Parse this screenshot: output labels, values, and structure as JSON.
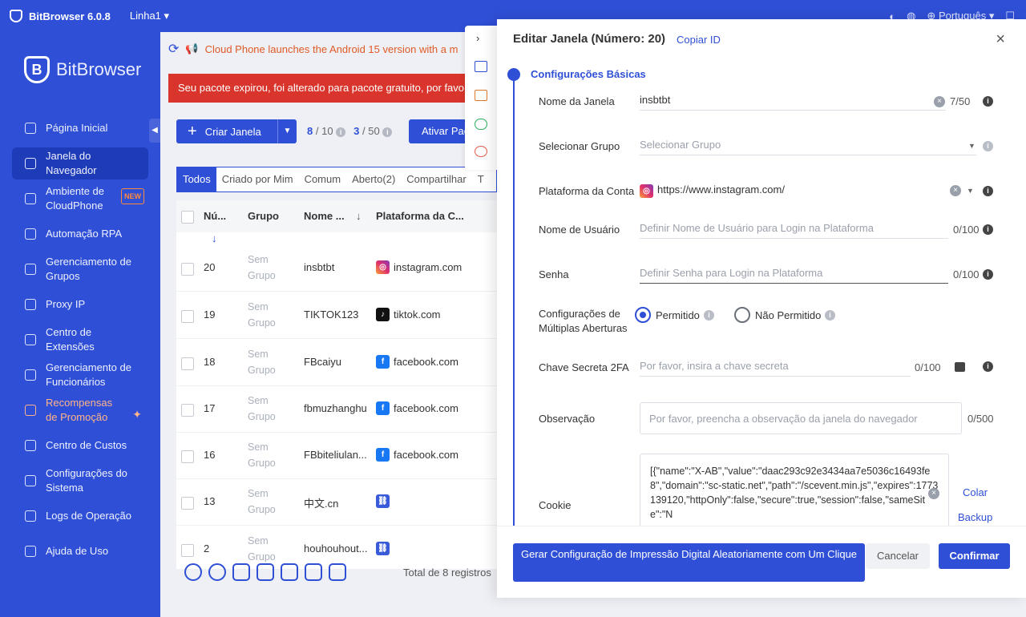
{
  "titlebar": {
    "app": "BitBrowser 6.0.8",
    "line": "Linha1",
    "language": "Português"
  },
  "brand": {
    "name": "BitBrowser"
  },
  "sidebar": {
    "items": [
      {
        "label": "Página Inicial"
      },
      {
        "label": "Janela do Navegador"
      },
      {
        "label": "Ambiente de CloudPhone",
        "badge": "NEW"
      },
      {
        "label": "Automação RPA"
      },
      {
        "label": "Gerenciamento de Grupos"
      },
      {
        "label": "Proxy IP"
      },
      {
        "label": "Centro de Extensões"
      },
      {
        "label": "Gerenciamento de Funcionários"
      },
      {
        "label": "Recompensas de Promoção"
      },
      {
        "label": "Centro de Custos"
      },
      {
        "label": "Configurações do Sistema"
      },
      {
        "label": "Logs de Operação"
      },
      {
        "label": "Ajuda de Uso"
      }
    ]
  },
  "main": {
    "notice": "Cloud Phone launches the Android 15 version with a m",
    "alert": "Seu pacote expirou, foi alterado para pacote gratuito, por favo",
    "create_label": "Criar Janela",
    "count1_a": "8",
    "count1_b": "/ 10",
    "count2_a": "3",
    "count2_b": "/ 50",
    "activate_label": "Ativar Pac",
    "tabs": [
      "Todos",
      "Criado por Mim",
      "Comum",
      "Aberto(2)",
      "Compartilhar",
      "T"
    ],
    "columns": [
      "Nú...",
      "Grupo",
      "Nome ...",
      "Plataforma da C..."
    ],
    "rows": [
      {
        "num": "20",
        "group": "Sem Grupo",
        "name": "insbtbt",
        "platform": "instagram.com",
        "icon": "instagram-icon"
      },
      {
        "num": "19",
        "group": "Sem Grupo",
        "name": "TIKTOK123",
        "platform": "tiktok.com",
        "icon": "tiktok-icon"
      },
      {
        "num": "18",
        "group": "Sem Grupo",
        "name": "FBcaiyu",
        "platform": "facebook.com",
        "icon": "facebook-icon"
      },
      {
        "num": "17",
        "group": "Sem Grupo",
        "name": "fbmuzhanghu",
        "platform": "facebook.com",
        "icon": "facebook-icon"
      },
      {
        "num": "16",
        "group": "Sem Grupo",
        "name": "FBbiteliulan...",
        "platform": "facebook.com",
        "icon": "facebook-icon"
      },
      {
        "num": "13",
        "group": "Sem Grupo",
        "name": "中文.cn",
        "platform": "",
        "icon": "link-icon"
      },
      {
        "num": "2",
        "group": "Sem Grupo",
        "name": "houhouhout...",
        "platform": "",
        "icon": "link-icon"
      }
    ],
    "total": "Total de 8 registros"
  },
  "modal": {
    "title": "Editar Janela (Número: 20)",
    "copy_id": "Copiar ID",
    "section": "Configurações Básicas",
    "window_name_label": "Nome da Janela",
    "window_name_value": "insbtbt",
    "window_name_count": "7/50",
    "group_label": "Selecionar Grupo",
    "group_placeholder": "Selecionar Grupo",
    "platform_label": "Plataforma da Conta",
    "platform_value": "https://www.instagram.com/",
    "username_label": "Nome de Usuário",
    "username_placeholder": "Definir Nome de Usuário para Login na Plataforma",
    "username_count": "0/100",
    "password_label": "Senha",
    "password_placeholder": "Definir Senha para Login na Plataforma",
    "password_count": "0/100",
    "multi_label": "Configurações de Múltiplas Aberturas",
    "multi_allowed": "Permitido",
    "multi_denied": "Não Permitido",
    "secret_label": "Chave Secreta 2FA",
    "secret_placeholder": "Por favor, insira a chave secreta",
    "secret_count": "0/100",
    "obs_label": "Observação",
    "obs_placeholder": "Por favor, preencha a observação da janela do navegador",
    "obs_count": "0/500",
    "cookie_label": "Cookie",
    "cookie_value": "[{\"name\":\"X-AB\",\"value\":\"daac293c92e3434aa7e5036c16493fe8\",\"domain\":\"sc-static.net\",\"path\":\"/scevent.min.js\",\"expires\":1773139120,\"httpOnly\":false,\"secure\":true,\"session\":false,\"sameSite\":\"N",
    "paste_label": "Colar",
    "backup_label": "Backup",
    "generate_label": "Gerar Configuração de Impressão Digital Aleatoriamente com Um Clique",
    "cancel_label": "Cancelar",
    "confirm_label": "Confirmar"
  },
  "colors": {
    "primary": "#2f4fd6",
    "alert": "#d9352c",
    "notice": "#e05a26"
  }
}
